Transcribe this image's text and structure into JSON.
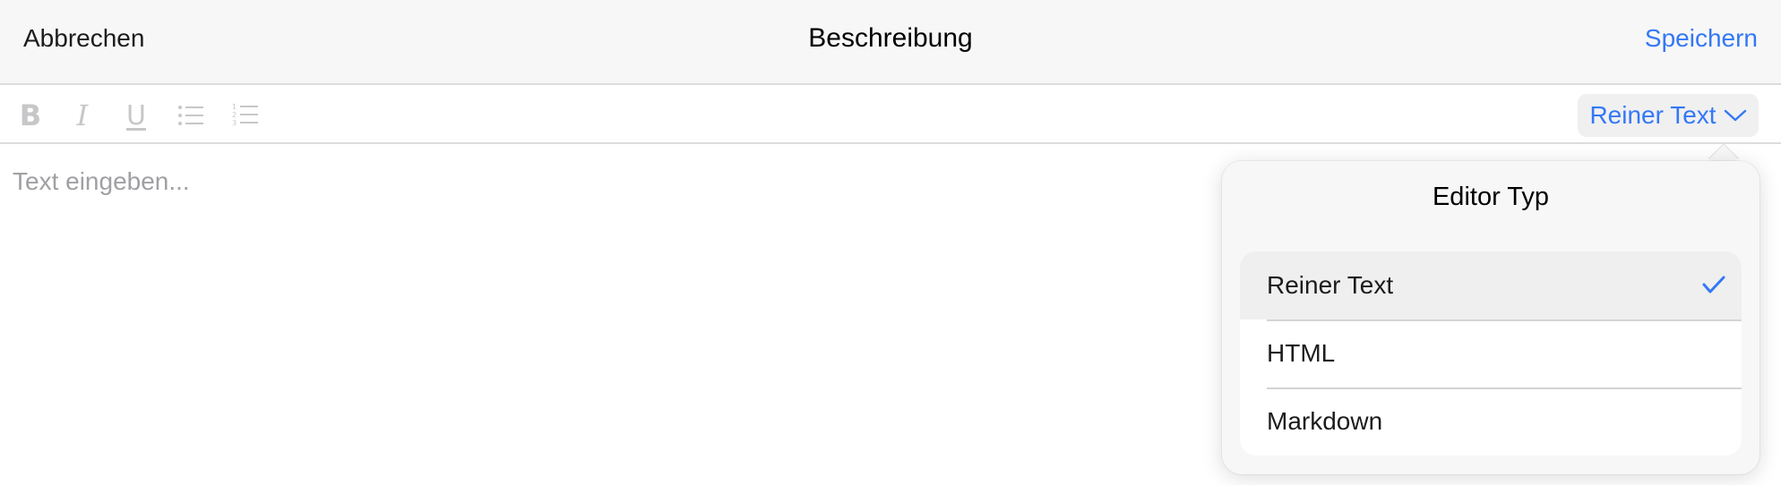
{
  "navbar": {
    "cancel_label": "Abbrechen",
    "title": "Beschreibung",
    "save_label": "Speichern"
  },
  "toolbar": {
    "bold_label": "B",
    "italic_label": "I",
    "underline_label": "U",
    "bullet_list_icon": "bullet-list-icon",
    "numbered_list_icon": "numbered-list-icon",
    "type_picker_label": "Reiner Text"
  },
  "editor": {
    "placeholder": "Text eingeben..."
  },
  "popover": {
    "title": "Editor Typ",
    "options": [
      {
        "label": "Reiner Text",
        "selected": true
      },
      {
        "label": "HTML",
        "selected": false
      },
      {
        "label": "Markdown",
        "selected": false
      }
    ]
  },
  "colors": {
    "accent": "#3478f6",
    "disabled_icon": "#c7c7c9",
    "placeholder": "#a0a0a4"
  }
}
